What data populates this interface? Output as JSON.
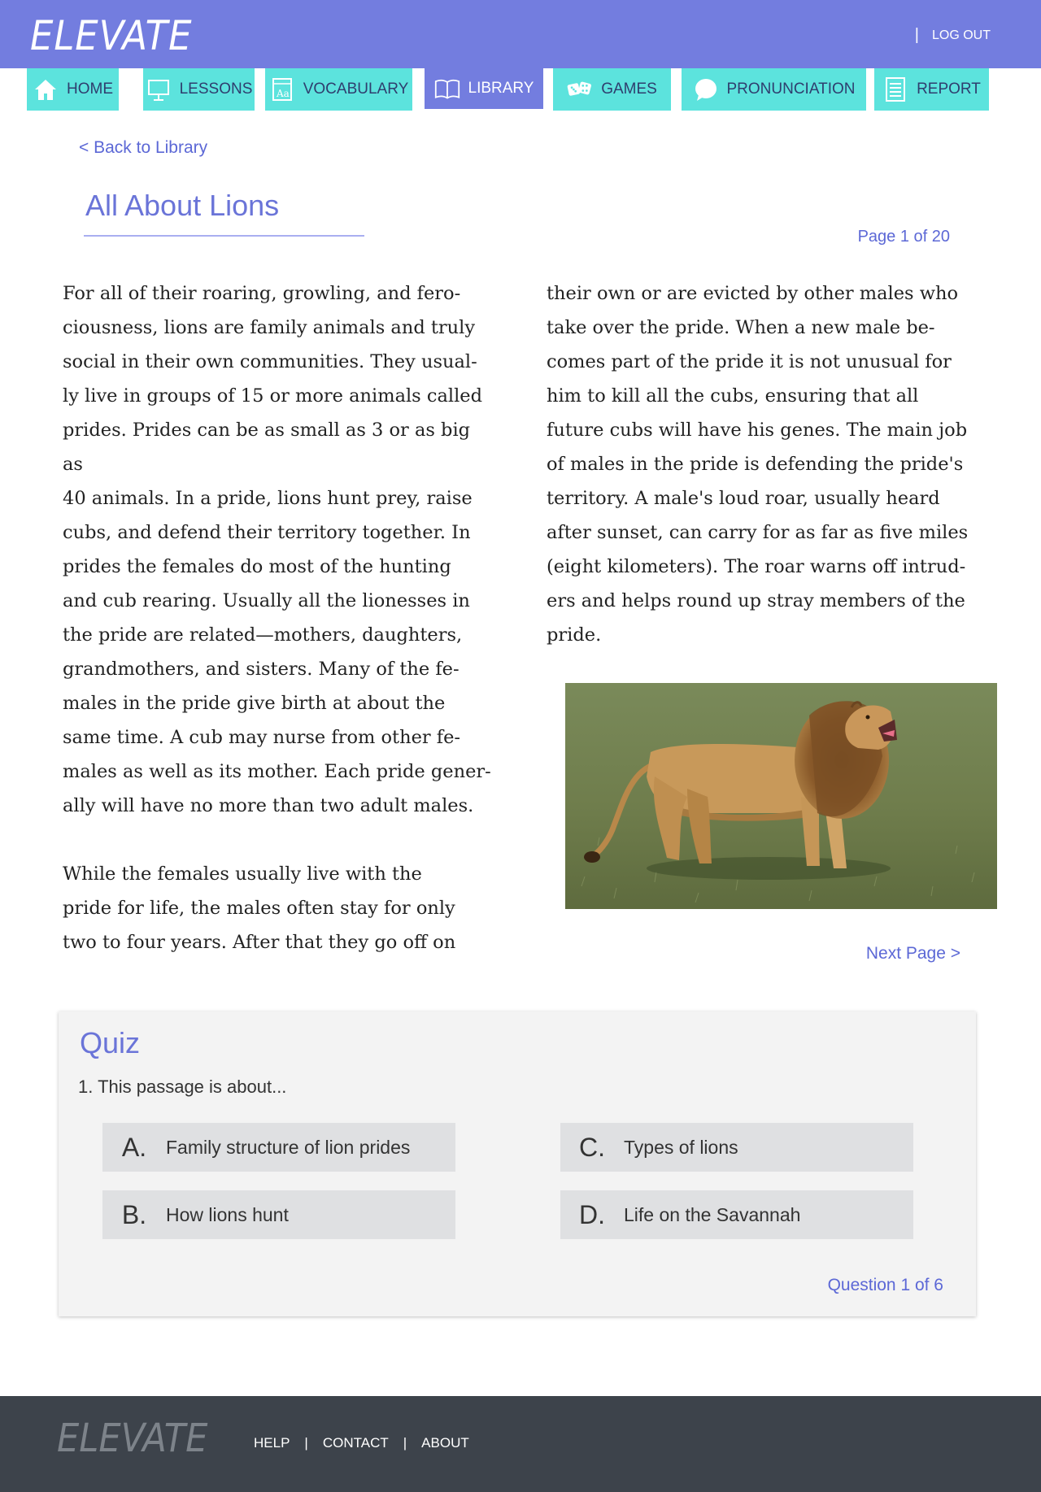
{
  "header": {
    "logo": "ELEVATE",
    "logout_label": "LOG OUT"
  },
  "nav": {
    "tabs": [
      {
        "label": "HOME",
        "icon": "home-icon",
        "active": false
      },
      {
        "label": "LESSONS",
        "icon": "presentation-board-icon",
        "active": false
      },
      {
        "label": "VOCABULARY",
        "icon": "dictionary-icon",
        "active": false
      },
      {
        "label": "LIBRARY",
        "icon": "open-book-icon",
        "active": true
      },
      {
        "label": "GAMES",
        "icon": "dice-icon",
        "active": false
      },
      {
        "label": "PRONUNCIATION",
        "icon": "speech-bubble-icon",
        "active": false
      },
      {
        "label": "REPORT",
        "icon": "report-document-icon",
        "active": false
      }
    ]
  },
  "reader": {
    "back_label": "< Back to Library",
    "title": "All About Lions",
    "page_indicator": "Page 1 of 20",
    "left_paragraphs": [
      "    For all of their roaring, growling, and fero-\nciousness, lions are family animals and truly\nsocial in their own communities. They usual-\nly live in groups of 15 or more animals called\nprides. Prides can be as small as 3 or as big as\n40 animals. In a pride, lions hunt prey, raise\ncubs, and defend their territory together. In\nprides the females do most of the hunting\nand cub rearing. Usually all the lionesses in\nthe pride are related—mothers, daughters,\ngrandmothers, and sisters. Many of the fe-\nmales in the pride give birth at about the\nsame time. A cub may nurse from other fe-\nmales as well as its mother. Each pride gener-\nally will have no more than two adult males.",
      "    While the females usually live with the\npride for life, the males often stay for only\ntwo to four years. After that they go off on"
    ],
    "right_paragraphs": [
      "their own or are evicted by other males who\ntake over the pride. When a new male be-\ncomes part of the pride it is not unusual for\nhim to kill all the cubs, ensuring that all\nfuture cubs will have his genes. The main job\nof males in the pride is defending the pride's\nterritory. A male's loud roar, usually heard\nafter sunset, can carry for as far as five miles\n(eight kilometers). The roar warns off intrud-\ners and helps round up stray members of the\npride."
    ],
    "next_label": "Next Page >"
  },
  "quiz": {
    "title": "Quiz",
    "question": "1. This passage is about...",
    "answers": [
      {
        "letter": "A.",
        "text": "Family structure of lion prides"
      },
      {
        "letter": "B.",
        "text": "How lions hunt"
      },
      {
        "letter": "C.",
        "text": "Types of lions"
      },
      {
        "letter": "D.",
        "text": "Life on the Savannah"
      }
    ],
    "question_count": "Question 1 of 6"
  },
  "footer": {
    "logo": "ELEVATE",
    "links": [
      "HELP",
      "CONTACT",
      "ABOUT"
    ]
  },
  "colors": {
    "header_bg": "#737ddf",
    "tab_bg": "#5ce3dd",
    "tab_active_bg": "#737ddf",
    "accent_text": "#5c68d6",
    "quiz_bg": "#f3f3f3",
    "answer_bg": "#dfe0e2",
    "footer_bg": "#3d434b"
  }
}
